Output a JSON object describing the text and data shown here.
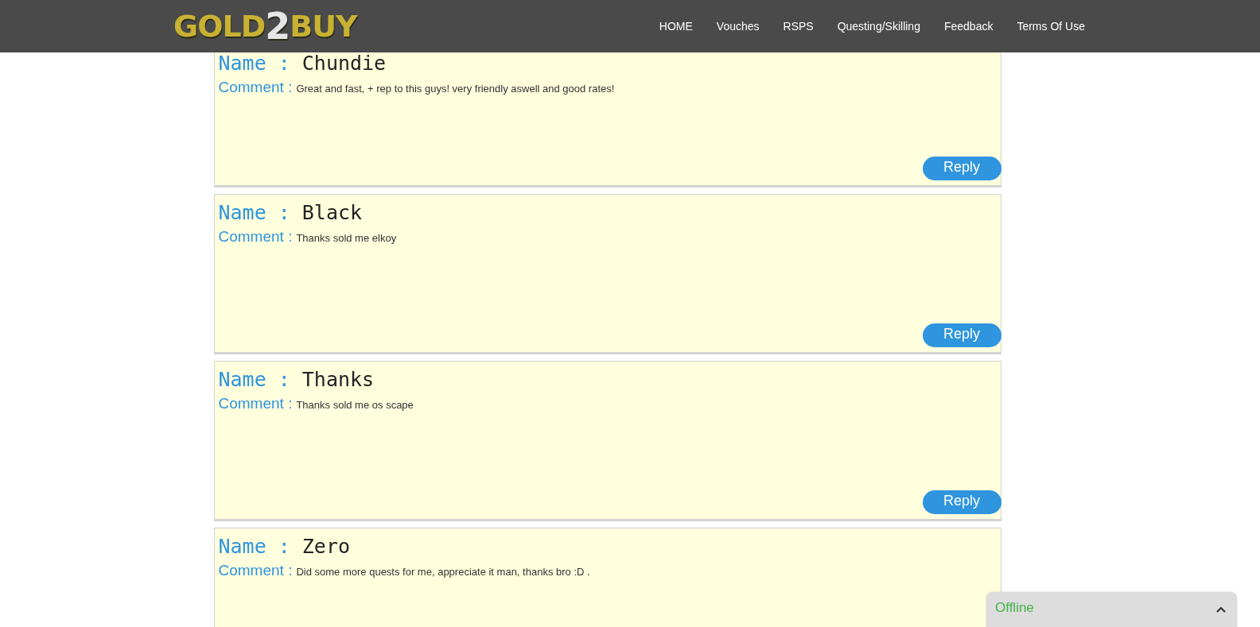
{
  "logo": {
    "parts": [
      "GOLD",
      "2",
      "BUY"
    ]
  },
  "nav": [
    {
      "label": "HOME"
    },
    {
      "label": "Vouches"
    },
    {
      "label": "RSPS"
    },
    {
      "label": "Questing/Skilling"
    },
    {
      "label": "Feedback"
    },
    {
      "label": "Terms Of Use"
    }
  ],
  "vouches": [
    {
      "name_label": "Name :",
      "name": "Chundie",
      "comment_label": "Comment :",
      "comment": "Great and fast, + rep to this guys! very friendly aswell and good rates!",
      "reply": "Reply"
    },
    {
      "name_label": "Name :",
      "name": "Black",
      "comment_label": "Comment :",
      "comment": "Thanks sold me elkoy",
      "reply": "Reply"
    },
    {
      "name_label": "Name :",
      "name": "Thanks",
      "comment_label": "Comment :",
      "comment": "Thanks sold me os scape",
      "reply": "Reply"
    },
    {
      "name_label": "Name :",
      "name": "Zero",
      "comment_label": "Comment :",
      "comment": "Did some more quests for me, appreciate it man, thanks bro :D ."
    }
  ],
  "chat": {
    "status": "Offline",
    "expanded": false
  }
}
